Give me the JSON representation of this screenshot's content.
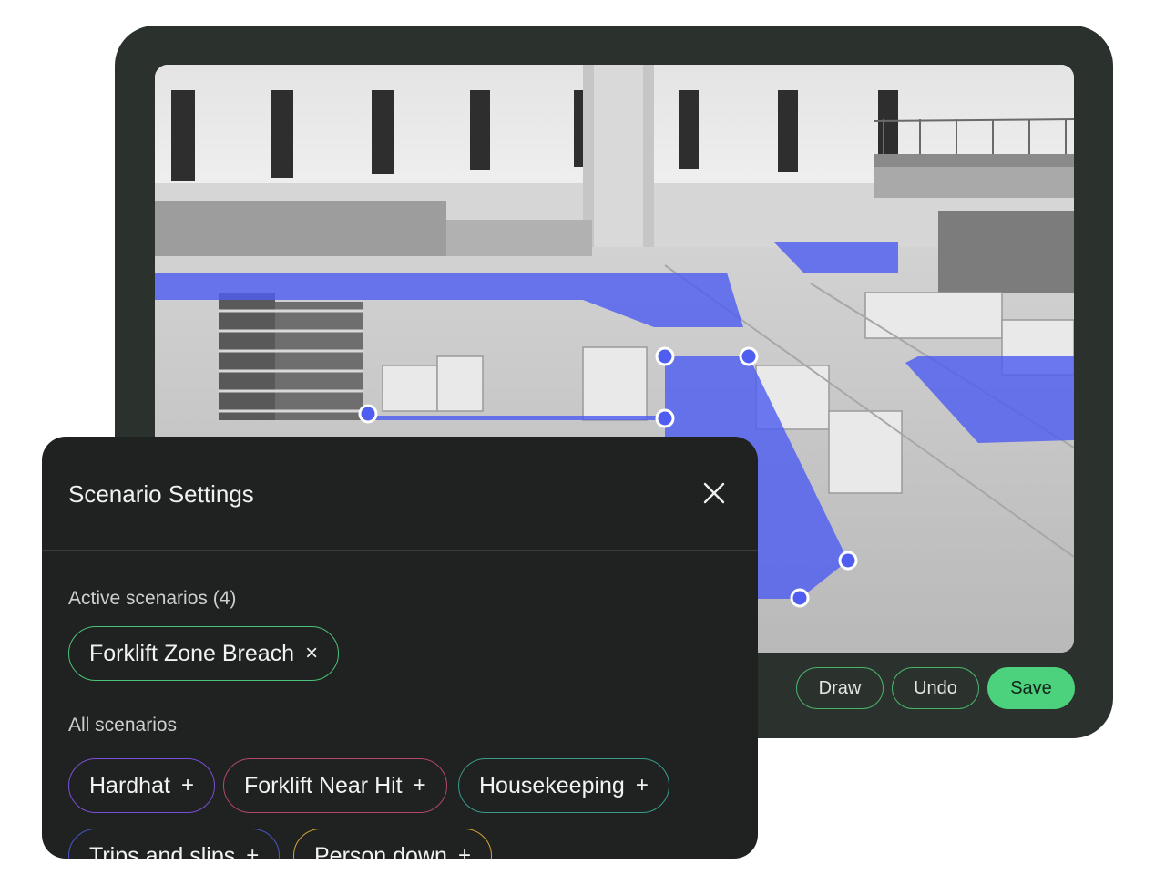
{
  "toolbar": {
    "draw_label": "Draw",
    "undo_label": "Undo",
    "save_label": "Save"
  },
  "panel": {
    "title": "Scenario Settings",
    "active_label": "Active scenarios (4)",
    "all_label": "All scenarios",
    "active_scenarios": [
      {
        "label": "Forklift Zone Breach",
        "action": "×"
      }
    ],
    "all_scenarios": [
      {
        "label": "Hardhat",
        "action": "+"
      },
      {
        "label": "Forklift Near Hit",
        "action": "+"
      },
      {
        "label": "Housekeeping",
        "action": "+"
      },
      {
        "label": "Trips and slips",
        "action": "+"
      },
      {
        "label": "Person down",
        "action": "+"
      }
    ]
  },
  "colors": {
    "zone_fill": "#4f5ef0",
    "accent_green": "#4cd27c",
    "chip_hardhat": "#7a4fd6",
    "chip_near_hit": "#b2476e",
    "chip_housekeeping": "#3a9c8e",
    "chip_trips": "#4a56c9",
    "chip_person_down": "#d6a23a"
  }
}
